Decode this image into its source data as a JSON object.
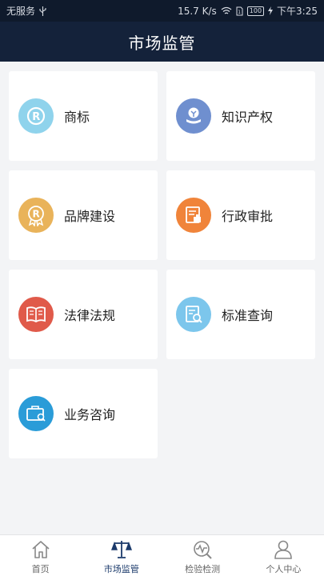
{
  "status_bar": {
    "carrier": "无服务",
    "speed": "15.7 K/s",
    "battery": "100",
    "time": "下午3:25"
  },
  "header": {
    "title": "市场监管"
  },
  "cards": [
    {
      "label": "商标",
      "icon": "trademark-icon",
      "color": "#8fd3ec"
    },
    {
      "label": "知识产权",
      "icon": "ip-bulb-icon",
      "color": "#6f8fcf"
    },
    {
      "label": "品牌建设",
      "icon": "brand-badge-icon",
      "color": "#e9b35a"
    },
    {
      "label": "行政审批",
      "icon": "approval-document-icon",
      "color": "#f0843a"
    },
    {
      "label": "法律法规",
      "icon": "law-book-icon",
      "color": "#e05a4a"
    },
    {
      "label": "标准查询",
      "icon": "standard-search-icon",
      "color": "#7cc6ec"
    },
    {
      "label": "业务咨询",
      "icon": "consult-briefcase-icon",
      "color": "#2a9cd8"
    }
  ],
  "tabs": [
    {
      "label": "首页",
      "icon": "home-icon",
      "active": false
    },
    {
      "label": "市场监管",
      "icon": "scales-icon",
      "active": true
    },
    {
      "label": "检验检测",
      "icon": "inspection-icon",
      "active": false
    },
    {
      "label": "个人中心",
      "icon": "person-icon",
      "active": false
    }
  ],
  "colors": {
    "header_bg": "#14223a",
    "active_tab": "#1b3a6b",
    "page_bg": "#f3f4f6"
  }
}
